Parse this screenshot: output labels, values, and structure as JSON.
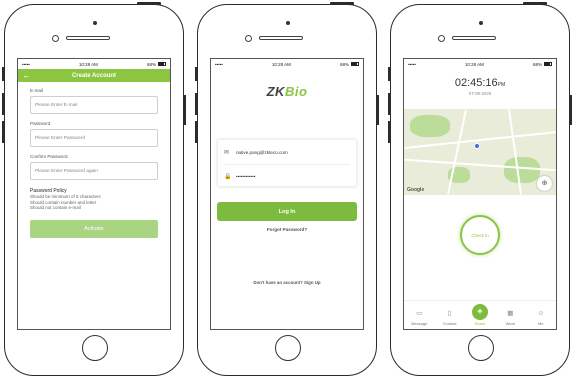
{
  "status": {
    "carrier": "•••••",
    "time": "10:28 AM",
    "battery": "68%"
  },
  "create_account": {
    "title": "Create Account",
    "back_icon": "←",
    "email_label": "E-mail",
    "email_placeholder": "Please Enter E-mail",
    "password_label": "Password",
    "password_placeholder": "Please Enter Password",
    "confirm_label": "Confirm Password",
    "confirm_placeholder": "Please Enter Password again",
    "policy_title": "Password Policy",
    "policy_lines": [
      "Should be minimum of 8 characters",
      "Should contain number and letter",
      "Should not contain e-mail"
    ],
    "activate_label": "Activate"
  },
  "login": {
    "logo_main": "ZK",
    "logo_accent": "Bio",
    "email_icon": "✉",
    "email_value": "native.pang@zkteco.com",
    "lock_icon": "🔒",
    "password_value": "••••••••••••",
    "login_label": "Log In",
    "forgot_label": "Forgot Password?",
    "signup_text": "Don't have an account?  Sign Up"
  },
  "home": {
    "time": "02:45:16",
    "time_suffix": "PM",
    "date": "07-08-2020",
    "map_brand": "Google",
    "locate_icon": "⊕",
    "checkin_label": "Check In",
    "tabs": [
      {
        "label": "Message",
        "icon": "▭"
      },
      {
        "label": "Contact",
        "icon": "▯"
      },
      {
        "label": "Home",
        "icon": "◈"
      },
      {
        "label": "Work",
        "icon": "▦"
      },
      {
        "label": "Me",
        "icon": "☺"
      }
    ]
  },
  "colors": {
    "accent": "#8cc540"
  }
}
